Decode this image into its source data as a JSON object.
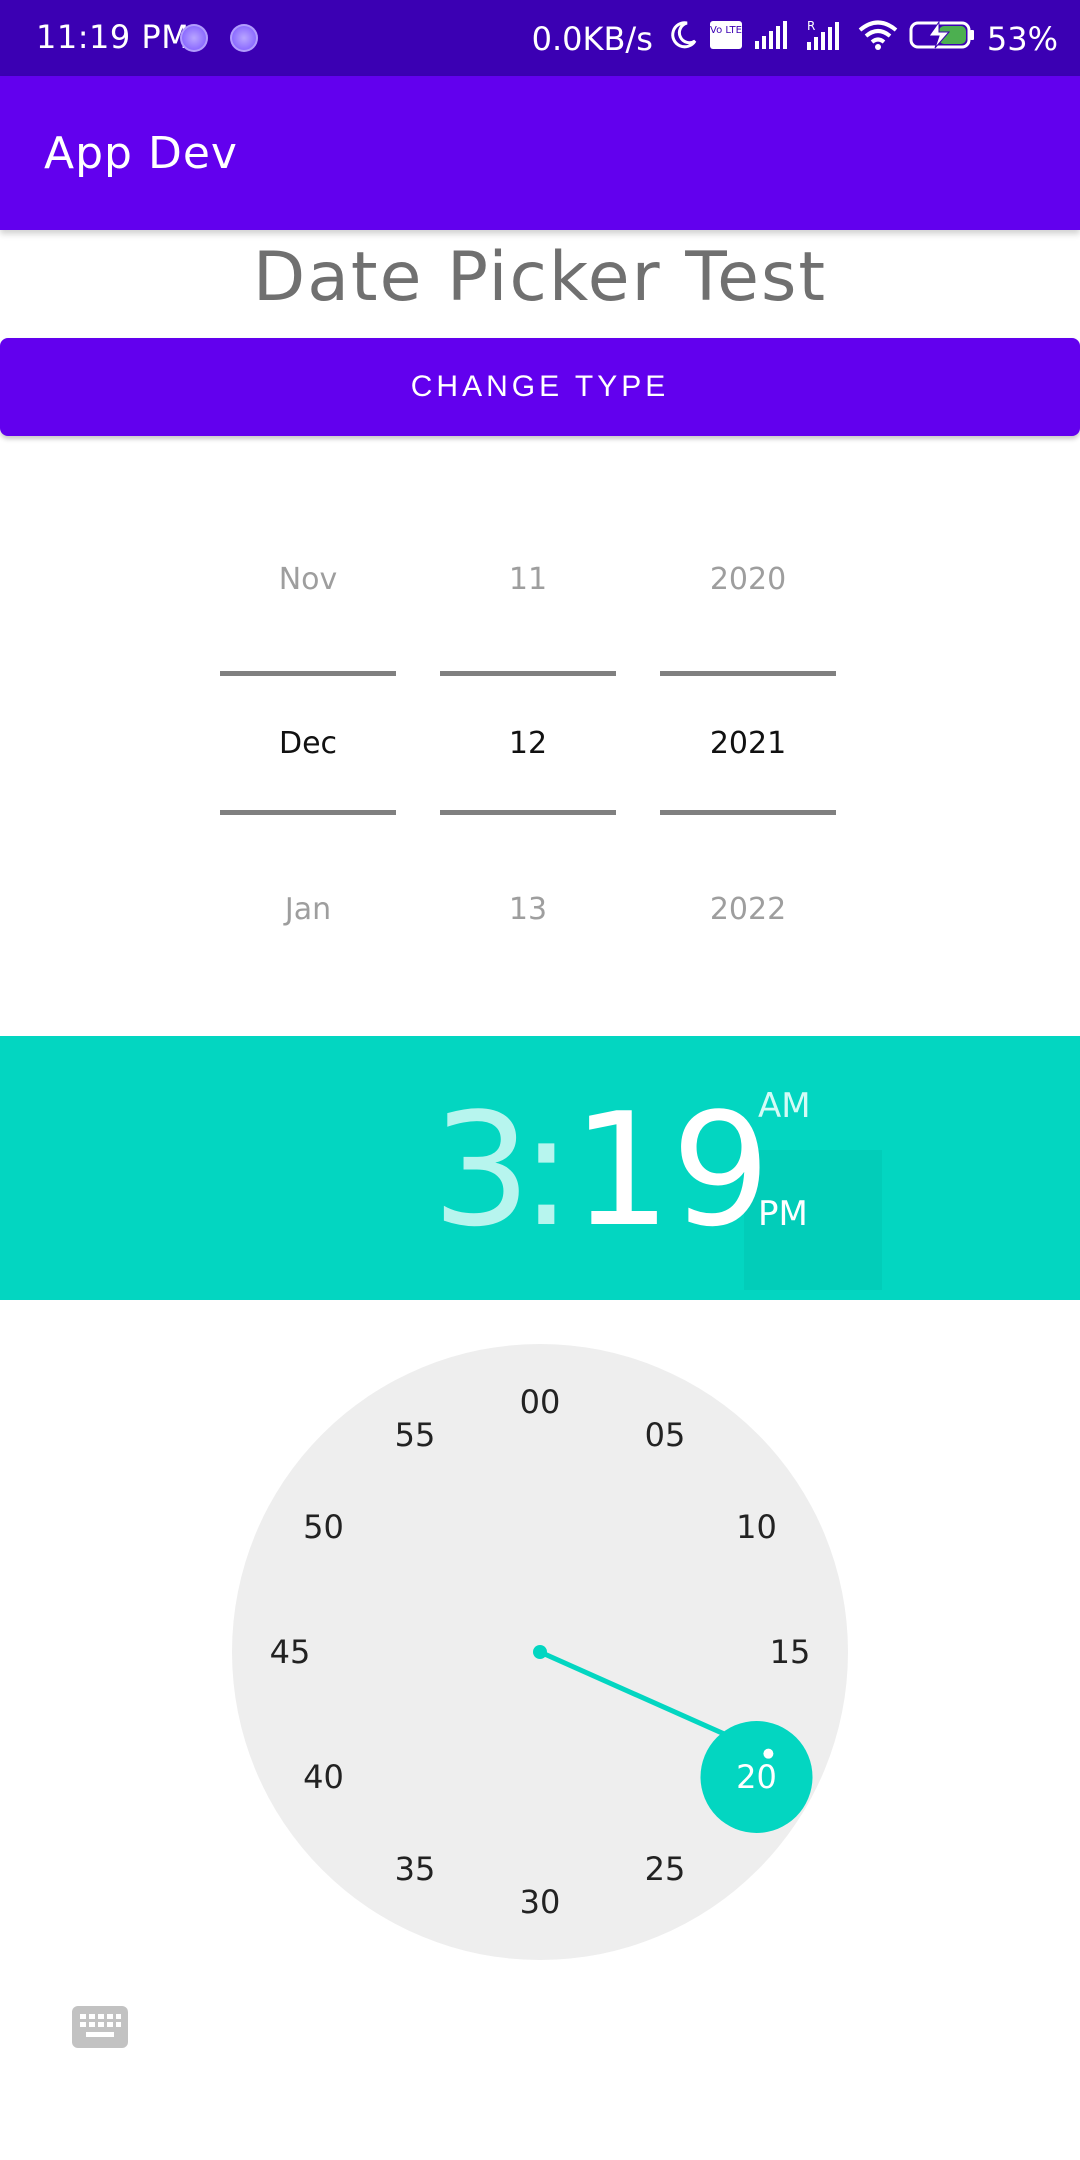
{
  "status_bar": {
    "time": "11:19 PM",
    "net_speed": "0.0KB/s",
    "battery_percent": "53%",
    "icons": [
      "notification-dot-icon",
      "notification-dot-icon",
      "moon-icon",
      "volte-icon",
      "signal-icon",
      "signal-roaming-icon",
      "wifi-icon",
      "battery-charging-icon"
    ],
    "volte_text": "Vo LTE",
    "roaming_mark": "R"
  },
  "app_bar": {
    "title": "App Dev"
  },
  "page": {
    "title": "Date Picker Test",
    "change_type_label": "CHANGE TYPE"
  },
  "date_picker": {
    "month": {
      "prev": "Nov",
      "selected": "Dec",
      "next": "Jan"
    },
    "day": {
      "prev": "11",
      "selected": "12",
      "next": "13"
    },
    "year": {
      "prev": "2020",
      "selected": "2021",
      "next": "2022"
    }
  },
  "time_picker": {
    "hour": "3",
    "separator": ":",
    "minute": "19",
    "am_label": "AM",
    "pm_label": "PM",
    "selected_period": "PM",
    "minute_dial": [
      "00",
      "05",
      "10",
      "15",
      "20",
      "25",
      "30",
      "35",
      "40",
      "45",
      "50",
      "55"
    ],
    "selected_minute_value": 19,
    "highlighted_dial_label": "20",
    "accent_color": "#03d6c1"
  },
  "colors": {
    "primary": "#6200ee",
    "status_bar": "#3b00b3",
    "accent": "#03d6c1"
  },
  "keyboard_toggle": {
    "icon": "keyboard-icon"
  }
}
